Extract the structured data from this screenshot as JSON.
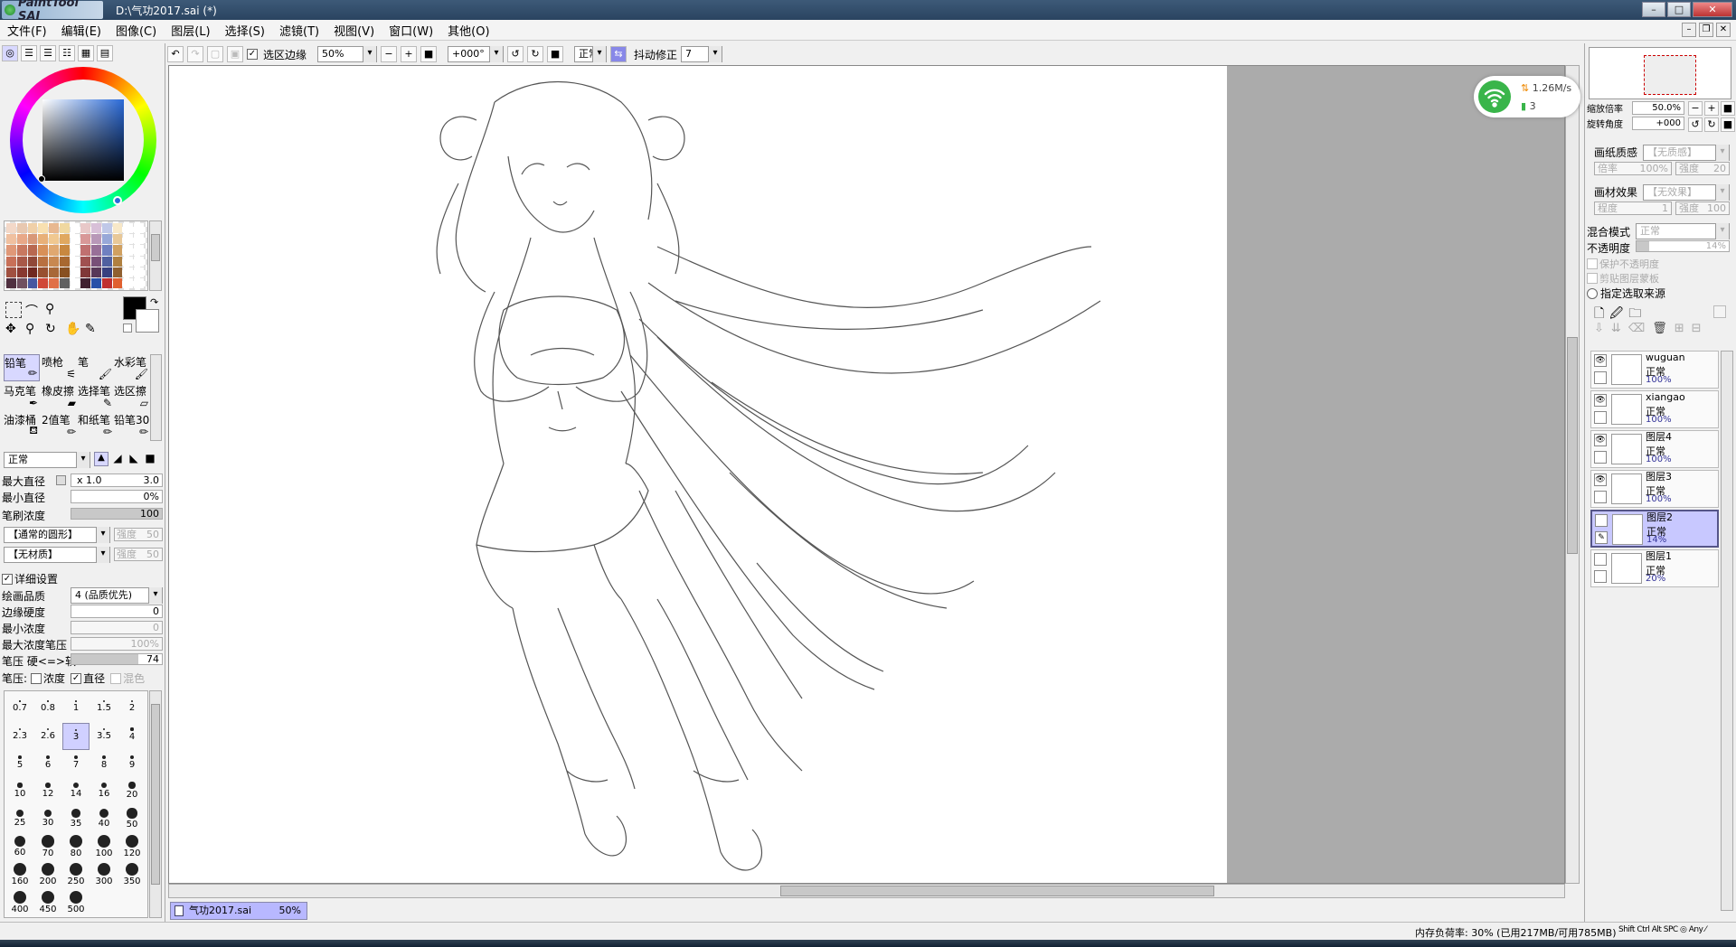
{
  "app": {
    "logo_text": "PaintTool SAI",
    "title": "D:\\气功2017.sai (*)"
  },
  "menu": [
    "文件(F)",
    "编辑(E)",
    "图像(C)",
    "图层(L)",
    "选择(S)",
    "滤镜(T)",
    "视图(V)",
    "窗口(W)",
    "其他(O)"
  ],
  "toolbar": {
    "select_edge_label": "选区边缘",
    "zoom": "50%",
    "rotation": "+000°",
    "blend": "正常",
    "stabilizer_label": "抖动修正",
    "stabilizer": "7"
  },
  "tools": [
    "铅笔",
    "喷枪",
    "笔",
    "水彩笔",
    "马克笔",
    "橡皮擦",
    "选择笔",
    "选区擦",
    "油漆桶",
    "2值笔",
    "和纸笔",
    "铅笔30"
  ],
  "brush": {
    "mode": "正常",
    "max_size_label": "最大直径",
    "max_size_mult": "x 1.0",
    "max_size": "3.0",
    "min_size_label": "最小直径",
    "min_size": "0%",
    "density_label": "笔刷浓度",
    "density": "100",
    "density_fraction": 1.0,
    "shape": "【通常的圆形】",
    "shape_strength_label": "强度",
    "shape_strength": "50",
    "texture": "【无材质】",
    "texture_strength_label": "强度",
    "texture_strength": "50",
    "adv_label": "详细设置",
    "quality_label": "绘画品质",
    "quality": "4 (品质优先)",
    "edge_label": "边缘硬度",
    "edge": "0",
    "min_density_label": "最小浓度",
    "min_density": "0",
    "max_pressure_label": "最大浓度笔压",
    "max_pressure": "100%",
    "pressure_label": "笔压 硬<=>软",
    "pressure": "74",
    "pressure_fraction": 0.74,
    "pressure_opts_label": "笔压:",
    "pressure_density": "浓度",
    "pressure_size": "直径",
    "pressure_blend": "混色"
  },
  "sizes": [
    "0.7",
    "0.8",
    "1",
    "1.5",
    "2",
    "2.3",
    "2.6",
    "3",
    "3.5",
    "4",
    "5",
    "6",
    "7",
    "8",
    "9",
    "10",
    "12",
    "14",
    "16",
    "20",
    "25",
    "30",
    "35",
    "40",
    "50",
    "60",
    "70",
    "80",
    "100",
    "120",
    "160",
    "200",
    "250",
    "300",
    "350",
    "400",
    "450",
    "500"
  ],
  "selected_size": "3",
  "navigator": {
    "zoom_label": "缩放倍率",
    "zoom": "50.0%",
    "angle_label": "旋转角度",
    "angle": "+000"
  },
  "paper": {
    "texture_label": "画纸质感",
    "texture": "【无质感】",
    "scale_label": "倍率",
    "scale": "100%",
    "strength_label": "强度",
    "strength": "20",
    "effect_label": "画材效果",
    "effect": "【无效果】",
    "degree_label": "程度",
    "degree": "1",
    "width_label": "强度",
    "width": "100"
  },
  "layer_props": {
    "blend_label": "混合模式",
    "blend": "正常",
    "opacity_label": "不透明度",
    "opacity": "14%",
    "opacity_fraction": 0.14,
    "preserve_label": "保护不透明度",
    "clip_label": "剪贴图层蒙板",
    "source_label": "指定选取来源"
  },
  "layers": [
    {
      "name": "wuguan",
      "mode": "正常",
      "opacity": "100%",
      "visible": true,
      "selected": false
    },
    {
      "name": "xiangao",
      "mode": "正常",
      "opacity": "100%",
      "visible": true,
      "selected": false
    },
    {
      "name": "图层4",
      "mode": "正常",
      "opacity": "100%",
      "visible": true,
      "selected": false
    },
    {
      "name": "图层3",
      "mode": "正常",
      "opacity": "100%",
      "visible": true,
      "selected": false
    },
    {
      "name": "图层2",
      "mode": "正常",
      "opacity": "14%",
      "visible": false,
      "selected": true
    },
    {
      "name": "图层1",
      "mode": "正常",
      "opacity": "20%",
      "visible": false,
      "selected": false
    }
  ],
  "network": {
    "speed": "1.26M/s",
    "count": "3"
  },
  "doc_tab": {
    "name": "气功2017.sai",
    "zoom": "50%"
  },
  "status": {
    "memory": "内存负荷率: 30% (已用217MB/可用785MB)",
    "keys": "Shift Ctrl Alt SPC ◎ Any ⁄"
  },
  "colors": {
    "current": "#000000",
    "secondary": "#ffffff",
    "selection": "#b8b8ff"
  }
}
